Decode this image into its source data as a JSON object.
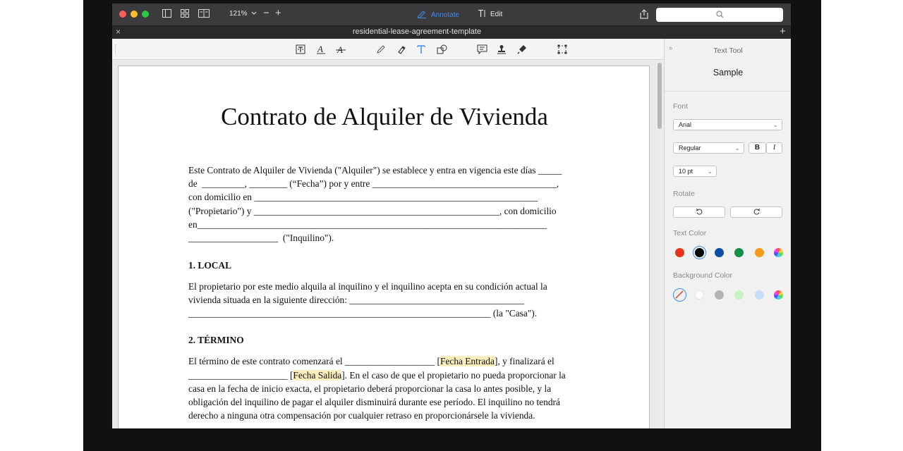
{
  "window": {
    "zoom": "121%",
    "mode_annotate": "Annotate",
    "mode_edit": "Edit"
  },
  "tab": {
    "title": "residential-lease-agreement-template"
  },
  "document": {
    "title": "Contrato de Alquiler de Vivienda",
    "intro_lines": [
      "Este Contrato de Alquiler de Vivienda (\"Alquiler\") se establece y entra en vigencia este días _____",
      "de  _________, ________ (“Fecha”) por y entre _______________________________________,",
      "con domicilio en ____________________________________________________________",
      "(\"Propietario\") y ____________________________________________________, con domicilio",
      "en__________________________________________________________________________",
      "___________________  (\"Inquilino\")."
    ],
    "section1": {
      "heading": "1. LOCAL",
      "lines": [
        "El propietario por este medio alquila al inquilino y el inquilino acepta en su condición actual la",
        "vivienda situada en la siguiente dirección: _____________________________________",
        "________________________________________________________________ (la \"Casa\")."
      ]
    },
    "section2": {
      "heading": "2. TÉRMINO",
      "line1_pre": "El término de este contrato comenzará el ___________________ [",
      "line1_hl": "Fecha Entrada",
      "line1_post": "], y finalizará el",
      "line2_pre": "_____________________ [",
      "line2_hl": "Fecha Salida",
      "line2_post": "]. En el caso de que el propietario no pueda proporcionar la",
      "lines": [
        "casa en la fecha de inicio exacta, el propietario deberá proporcionar la casa lo antes posible, y la",
        "obligación del inquilino de pagar el alquiler disminuirá durante ese período. El inquilino no tendrá",
        "derecho a ninguna otra compensación por cualquier retraso en proporcionársele la vivienda."
      ]
    }
  },
  "inspector": {
    "collapse_glyph": "»",
    "title": "Text Tool",
    "sample": "Sample",
    "font_label": "Font",
    "font_family": "Arial",
    "font_style": "Regular",
    "bold": "B",
    "italic": "I",
    "font_size": "10 pt",
    "rotate_label": "Rotate",
    "text_color_label": "Text Color",
    "text_colors": [
      "#e8321c",
      "#000000",
      "#0b4fa8",
      "#12904a",
      "#f59a1a"
    ],
    "background_color_label": "Background Color",
    "background_colors": [
      "#ffffff",
      "#b4b4b4",
      "#c9f2c5",
      "#c5def5"
    ]
  },
  "colors": {
    "accent": "#3e8bf0",
    "highlight": "#fbefbe"
  }
}
